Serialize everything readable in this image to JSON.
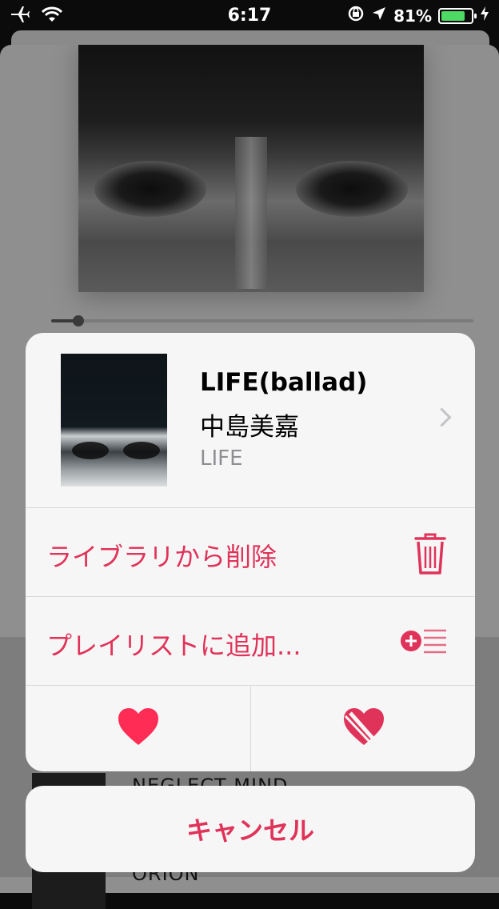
{
  "status_bar": {
    "time": "6:17",
    "battery_percent": "81%",
    "battery_level": 0.81,
    "icons": [
      "airplane-icon",
      "wifi-icon",
      "rotation-lock-icon",
      "location-icon",
      "battery-icon",
      "charging-icon"
    ]
  },
  "background": {
    "songs": [
      "NEGLECT MIND",
      "ORION"
    ]
  },
  "action_sheet": {
    "song": {
      "title": "LIFE(ballad)",
      "artist": "中島美嘉",
      "album": "LIFE"
    },
    "actions": [
      {
        "label": "ライブラリから削除",
        "icon": "trash-icon"
      },
      {
        "label": "プレイリストに追加...",
        "icon": "add-to-playlist-icon"
      }
    ],
    "love_icon": "heart-icon",
    "dislike_icon": "broken-heart-icon"
  },
  "cancel": {
    "label": "キャンセル"
  },
  "colors": {
    "accent": "#e0335a",
    "battery": "#4cd964"
  }
}
